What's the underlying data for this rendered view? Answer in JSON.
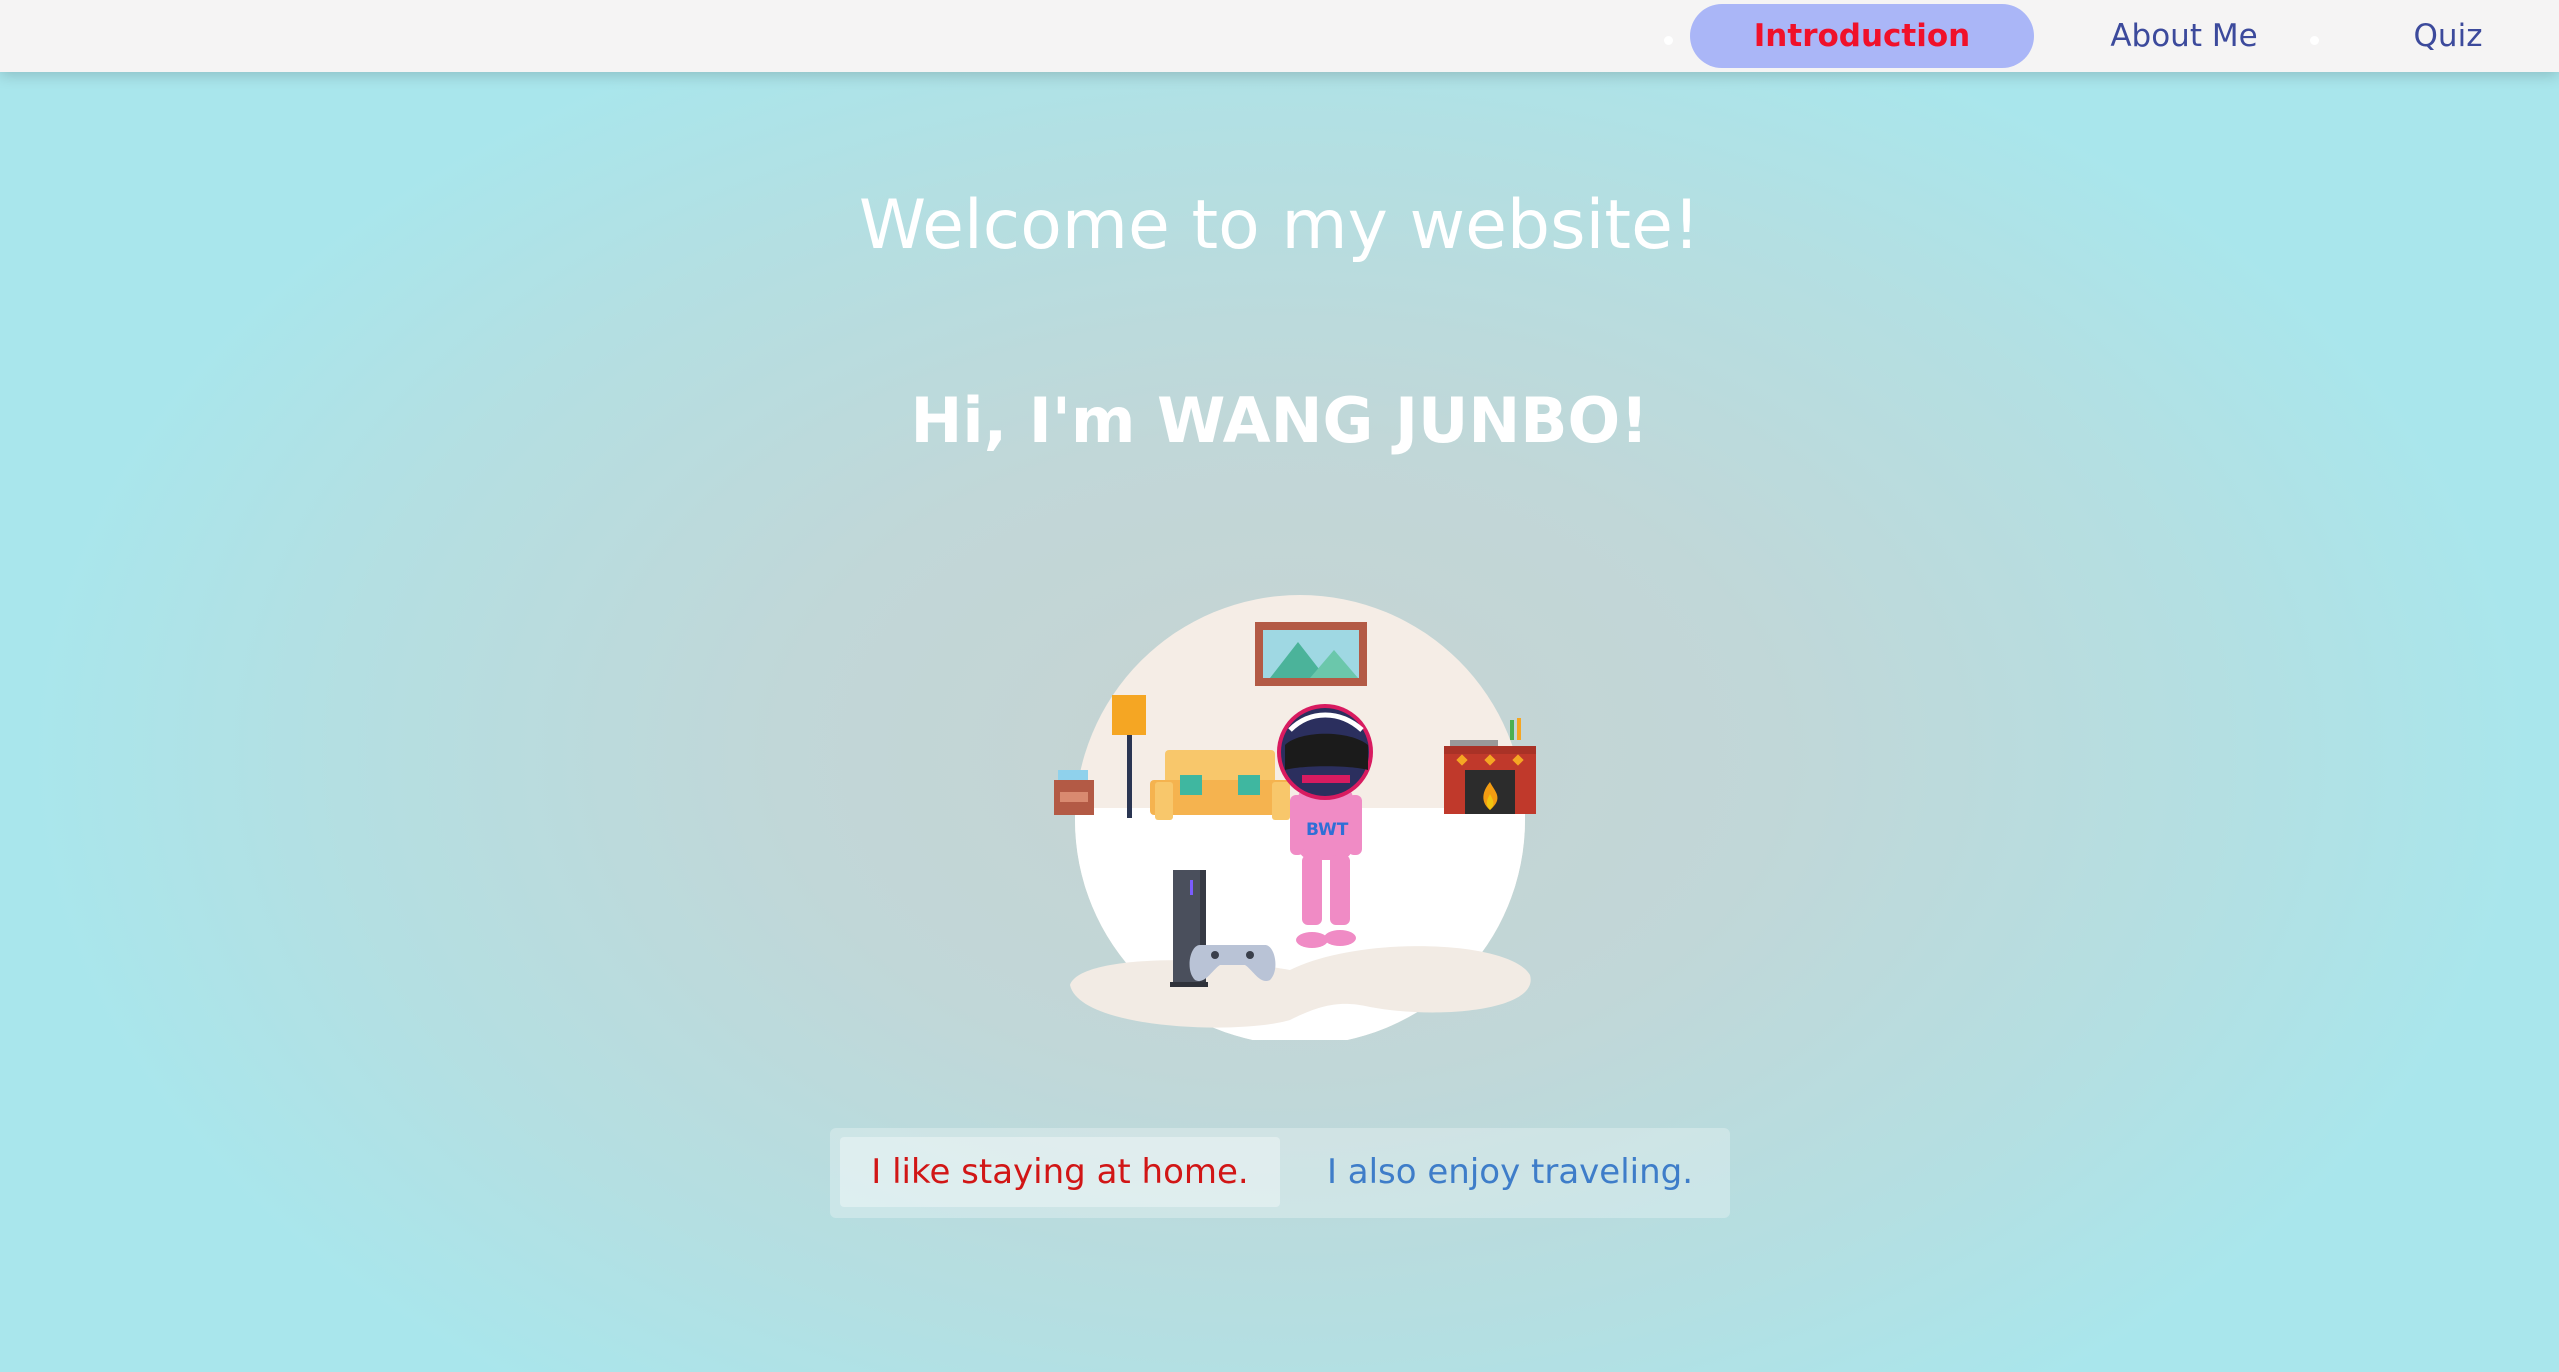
{
  "nav": {
    "items": [
      {
        "label": "Introduction",
        "active": true
      },
      {
        "label": "About Me",
        "active": false
      },
      {
        "label": "Quiz",
        "active": false
      }
    ]
  },
  "main": {
    "welcome": "Welcome to my website!",
    "greeting": "Hi, I'm WANG JUNBO!",
    "illustration_text": "BWT"
  },
  "toggle": {
    "home_label": "I like staying at home.",
    "travel_label": "I also enjoy traveling."
  },
  "colors": {
    "active_nav_bg": "#aab6f7",
    "active_nav_text": "#f0112a",
    "nav_text": "#3c4a9c",
    "home_text": "#d11616",
    "travel_text": "#3e7dc9"
  }
}
